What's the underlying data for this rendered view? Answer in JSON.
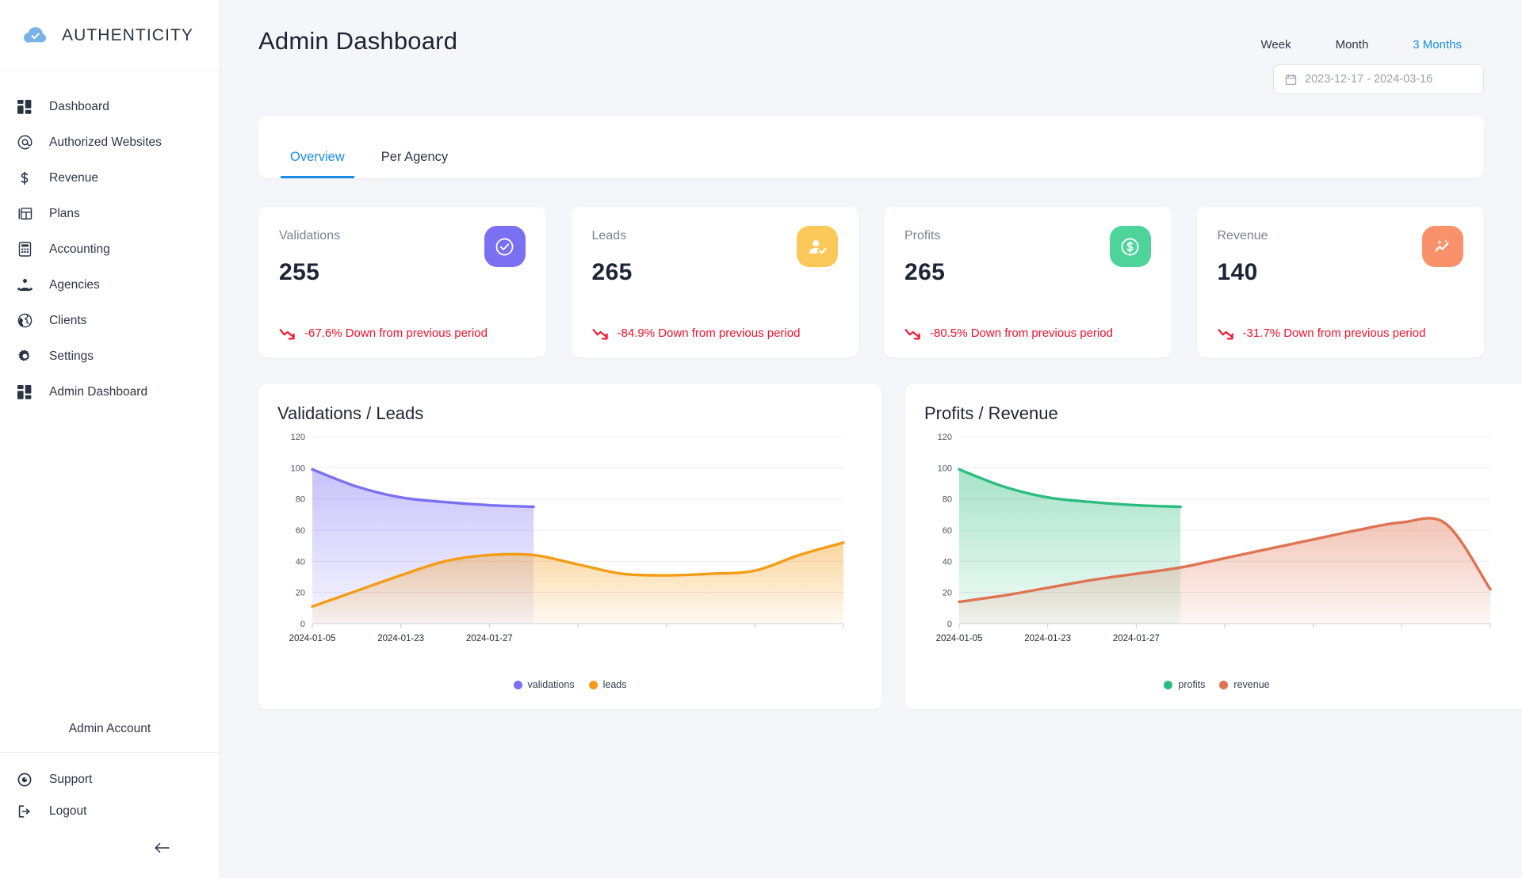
{
  "brand": {
    "name": "AUTHENTICITY",
    "logo_icon": "cloud-check-icon",
    "logo_color": "#79b2e8"
  },
  "sidebar": {
    "items": [
      {
        "label": "Dashboard",
        "icon": "dashboard-grid-icon"
      },
      {
        "label": "Authorized Websites",
        "icon": "at-sign-icon"
      },
      {
        "label": "Revenue",
        "icon": "dollar-sign-icon"
      },
      {
        "label": "Plans",
        "icon": "book-layout-icon"
      },
      {
        "label": "Accounting",
        "icon": "calculator-icon"
      },
      {
        "label": "Agencies",
        "icon": "org-chart-icon"
      },
      {
        "label": "Clients",
        "icon": "globe-icon"
      },
      {
        "label": "Settings",
        "icon": "gear-icon"
      },
      {
        "label": "Admin Dashboard",
        "icon": "dashboard-grid-icon"
      }
    ],
    "account_label": "Admin Account",
    "footer_items": [
      {
        "label": "Support",
        "icon": "lifebuoy-icon"
      },
      {
        "label": "Logout",
        "icon": "logout-arrow-icon"
      }
    ],
    "collapse_icon": "arrow-left-icon"
  },
  "header": {
    "title": "Admin Dashboard",
    "range_tabs": [
      {
        "label": "Week",
        "active": false
      },
      {
        "label": "Month",
        "active": false
      },
      {
        "label": "3 Months",
        "active": true
      }
    ],
    "date_range": "2023-12-17 - 2024-03-16",
    "calendar_icon": "calendar-icon",
    "accent_color": "#1a8de8"
  },
  "tabs": [
    {
      "label": "Overview",
      "active": true
    },
    {
      "label": "Per Agency",
      "active": false
    }
  ],
  "cards": [
    {
      "label": "Validations",
      "value": "255",
      "icon": "check-circle-icon",
      "icon_bg": "#7b6ff2",
      "delta": "-67.6% Down from previous period",
      "delta_color": "#f2112b",
      "delta_icon": "trend-down-icon"
    },
    {
      "label": "Leads",
      "value": "265",
      "icon": "user-check-icon",
      "icon_bg": "#fbc85a",
      "delta": "-84.9% Down from previous period",
      "delta_color": "#f2112b",
      "delta_icon": "trend-down-icon"
    },
    {
      "label": "Profits",
      "value": "265",
      "icon": "dollar-circle-icon",
      "icon_bg": "#4ed49a",
      "delta": "-80.5% Down from previous period",
      "delta_color": "#f2112b",
      "delta_icon": "trend-down-icon"
    },
    {
      "label": "Revenue",
      "value": "140",
      "icon": "sparkle-chart-icon",
      "icon_bg": "#f9916b",
      "delta": "-31.7% Down from previous period",
      "delta_color": "#f2112b",
      "delta_icon": "trend-down-icon"
    }
  ],
  "chart_data": [
    {
      "type": "area",
      "title": "Validations / Leads",
      "xlabel": "",
      "ylabel": "",
      "ylim": [
        0,
        120
      ],
      "yticks": [
        0,
        20,
        40,
        60,
        80,
        100,
        120
      ],
      "grid": true,
      "legend_position": "bottom",
      "xtick_labels": [
        "2024-01-05",
        "2024-01-23",
        "2024-01-27"
      ],
      "x": [
        0,
        1,
        2,
        3,
        4,
        5,
        6,
        7,
        8,
        9,
        10,
        11,
        12
      ],
      "series": [
        {
          "name": "validations",
          "color": "#7b6ff2",
          "values": [
            99,
            88,
            81,
            78,
            76,
            75,
            null,
            null,
            null,
            null,
            null,
            null,
            null
          ]
        },
        {
          "name": "leads",
          "color": "#f59c16",
          "values": [
            11,
            21,
            31,
            40,
            44,
            44,
            38,
            32,
            31,
            32,
            34,
            44,
            52
          ]
        }
      ]
    },
    {
      "type": "area",
      "title": "Profits / Revenue",
      "xlabel": "",
      "ylabel": "",
      "ylim": [
        0,
        120
      ],
      "yticks": [
        0,
        20,
        40,
        60,
        80,
        100,
        120
      ],
      "grid": true,
      "legend_position": "bottom",
      "xtick_labels": [
        "2024-01-05",
        "2024-01-23",
        "2024-01-27"
      ],
      "x": [
        0,
        1,
        2,
        3,
        4,
        5,
        6,
        7,
        8,
        9,
        10,
        11,
        12
      ],
      "series": [
        {
          "name": "profits",
          "color": "#2bbd7e",
          "values": [
            99,
            88,
            81,
            78,
            76,
            75,
            null,
            null,
            null,
            null,
            null,
            null,
            null
          ]
        },
        {
          "name": "revenue",
          "color": "#df7352",
          "values": [
            14,
            18,
            23,
            28,
            32,
            36,
            42,
            48,
            54,
            60,
            65,
            64,
            22
          ]
        }
      ]
    }
  ]
}
